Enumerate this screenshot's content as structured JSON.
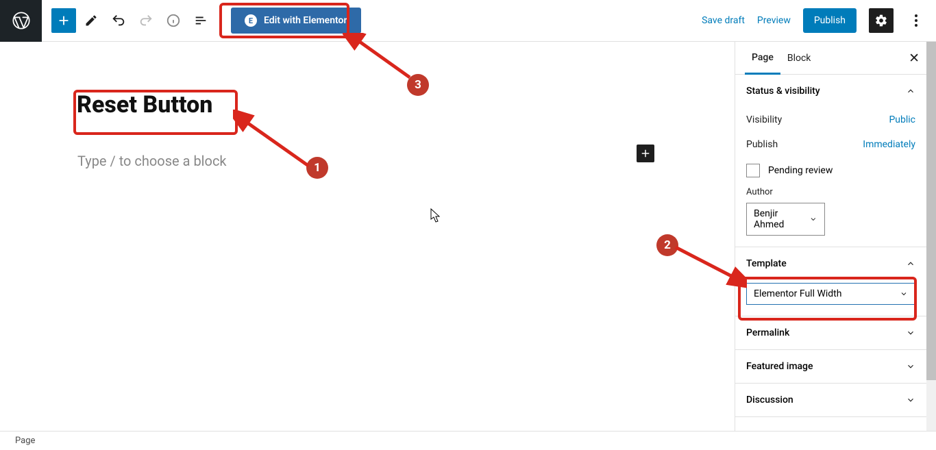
{
  "toolbar": {
    "editElementor": "Edit with Elementor"
  },
  "actions": {
    "saveDraft": "Save draft",
    "preview": "Preview",
    "publish": "Publish"
  },
  "editor": {
    "title": "Reset Button",
    "placeholder": "Type / to choose a block"
  },
  "sidebar": {
    "tabs": {
      "page": "Page",
      "block": "Block"
    },
    "status": {
      "heading": "Status & visibility",
      "visibilityLabel": "Visibility",
      "visibilityValue": "Public",
      "publishLabel": "Publish",
      "publishValue": "Immediately",
      "pending": "Pending review",
      "authorLabel": "Author",
      "authorValue": "Benjir Ahmed"
    },
    "template": {
      "heading": "Template",
      "value": "Elementor Full Width"
    },
    "permalink": "Permalink",
    "featured": "Featured image",
    "discussion": "Discussion"
  },
  "footer": {
    "breadcrumb": "Page"
  },
  "annotations": {
    "a1": "1",
    "a2": "2",
    "a3": "3"
  }
}
